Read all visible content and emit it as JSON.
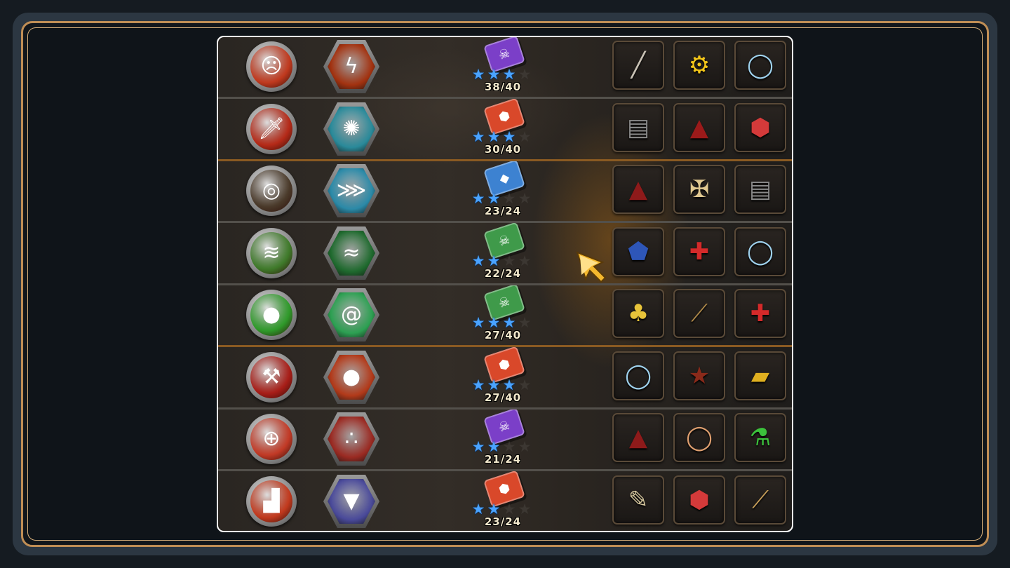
{
  "colors": {
    "frame_gold": "#c08e55",
    "panel_border": "#ffffff",
    "star_on": "#4aa3ff",
    "count_text": "#f2e8cc",
    "cursor": "#f5b82e"
  },
  "star_max": 4,
  "rows": [
    {
      "hero": {
        "icon": "screaming-face-icon",
        "glyph": "☹",
        "bg": "#c0391e"
      },
      "skill": {
        "icon": "lightning-icon",
        "glyph": "ϟ",
        "bg": "#a23210"
      },
      "book": {
        "icon": "purple-skull-book-icon",
        "glyph": "☠",
        "color": "#7b3fc8"
      },
      "stars": 3,
      "count": "38/40",
      "items": [
        {
          "icon": "spear-icon",
          "glyph": "╱",
          "color": "#c9c2b5"
        },
        {
          "icon": "gear-icon",
          "glyph": "⚙",
          "color": "#f2c51a"
        },
        {
          "icon": "ring-icon",
          "glyph": "◯",
          "color": "#9fd2ee"
        }
      ]
    },
    {
      "hero": {
        "icon": "sword-icon",
        "glyph": "🗡",
        "bg": "#b52a18"
      },
      "skill": {
        "icon": "energy-burst-icon",
        "glyph": "✺",
        "bg": "#2a8a9a"
      },
      "book": {
        "icon": "orange-book-icon",
        "glyph": "⬢",
        "color": "#d9482a"
      },
      "stars": 3,
      "count": "30/40",
      "items": [
        {
          "icon": "stone-tablet-icon",
          "glyph": "▤",
          "color": "#8a8a8a"
        },
        {
          "icon": "red-hood-icon",
          "glyph": "▲",
          "color": "#9b1a1a"
        },
        {
          "icon": "red-gem-icon",
          "glyph": "⬢",
          "color": "#d43a3a"
        }
      ]
    },
    {
      "hero": {
        "icon": "gear-wheel-icon",
        "glyph": "◎",
        "bg": "#4a3a2a"
      },
      "skill": {
        "icon": "fish-swarm-icon",
        "glyph": "⋙",
        "bg": "#2b8aa8"
      },
      "book": {
        "icon": "blue-book-icon",
        "glyph": "◆",
        "color": "#3d82d1"
      },
      "stars": 2,
      "count": "23/24",
      "items": [
        {
          "icon": "red-boot-icon",
          "glyph": "▲",
          "color": "#8e1a1a"
        },
        {
          "icon": "golden-sword-icon",
          "glyph": "✠",
          "color": "#e0c890"
        },
        {
          "icon": "stone-tablet-icon",
          "glyph": "▤",
          "color": "#8a8a8a"
        }
      ]
    },
    {
      "hero": {
        "icon": "wind-claw-icon",
        "glyph": "≋",
        "bg": "#3f7a2a"
      },
      "skill": {
        "icon": "green-vortex-icon",
        "glyph": "≈",
        "bg": "#1f6a2e"
      },
      "book": {
        "icon": "green-skull-book-icon",
        "glyph": "☠",
        "color": "#3f9a4a"
      },
      "stars": 2,
      "count": "22/24",
      "items": [
        {
          "icon": "blue-crystal-icon",
          "glyph": "⬟",
          "color": "#2e56b8"
        },
        {
          "icon": "first-aid-kit-icon",
          "glyph": "✚",
          "color": "#d42a2a"
        },
        {
          "icon": "ring-icon",
          "glyph": "◯",
          "color": "#9fd2ee"
        }
      ]
    },
    {
      "hero": {
        "icon": "green-bubbles-icon",
        "glyph": "●",
        "bg": "#2f9a2a"
      },
      "skill": {
        "icon": "green-swirl-icon",
        "glyph": "@",
        "bg": "#2da052"
      },
      "book": {
        "icon": "green-skull-book-icon",
        "glyph": "☠",
        "color": "#3f9a4a"
      },
      "stars": 3,
      "count": "27/40",
      "items": [
        {
          "icon": "clover-icon",
          "glyph": "♣",
          "color": "#e8c43a"
        },
        {
          "icon": "broom-icon",
          "glyph": "⟋",
          "color": "#b08a4a"
        },
        {
          "icon": "first-aid-kit-icon",
          "glyph": "✚",
          "color": "#d42a2a"
        }
      ]
    },
    {
      "hero": {
        "icon": "axe-icon",
        "glyph": "⚒",
        "bg": "#a81e18"
      },
      "skill": {
        "icon": "bomb-icon",
        "glyph": "●",
        "bg": "#b23a1a"
      },
      "book": {
        "icon": "orange-book-icon",
        "glyph": "⬢",
        "color": "#d9482a"
      },
      "stars": 3,
      "count": "27/40",
      "items": [
        {
          "icon": "ring-icon",
          "glyph": "◯",
          "color": "#9fd2ee"
        },
        {
          "icon": "spellbook-icon",
          "glyph": "★",
          "color": "#8a2a1a"
        },
        {
          "icon": "gold-ingot-icon",
          "glyph": "▰",
          "color": "#e0b020"
        }
      ]
    },
    {
      "hero": {
        "icon": "target-crosshair-icon",
        "glyph": "⊕",
        "bg": "#c23a26"
      },
      "skill": {
        "icon": "footprints-icon",
        "glyph": "∴",
        "bg": "#9a2a22"
      },
      "book": {
        "icon": "purple-skull-book-icon",
        "glyph": "☠",
        "color": "#7b3fc8"
      },
      "stars": 2,
      "count": "21/24",
      "items": [
        {
          "icon": "red-boot-icon",
          "glyph": "▲",
          "color": "#8e1a1a"
        },
        {
          "icon": "gold-ring-icon",
          "glyph": "◯",
          "color": "#e0a070"
        },
        {
          "icon": "green-potion-icon",
          "glyph": "⚗",
          "color": "#3cc23c"
        }
      ]
    },
    {
      "hero": {
        "icon": "blue-boot-icon",
        "glyph": "▟",
        "bg": "#c23a1e"
      },
      "skill": {
        "icon": "tornado-icon",
        "glyph": "▼",
        "bg": "#4a4a9a"
      },
      "book": {
        "icon": "orange-book-icon",
        "glyph": "⬢",
        "color": "#d9482a"
      },
      "stars": 2,
      "count": "23/24",
      "items": [
        {
          "icon": "scroll-quill-icon",
          "glyph": "✎",
          "color": "#d8c9a0"
        },
        {
          "icon": "red-gem-icon",
          "glyph": "⬢",
          "color": "#d43a3a"
        },
        {
          "icon": "magic-staff-icon",
          "glyph": "⟋",
          "color": "#c9a05a"
        }
      ]
    }
  ]
}
